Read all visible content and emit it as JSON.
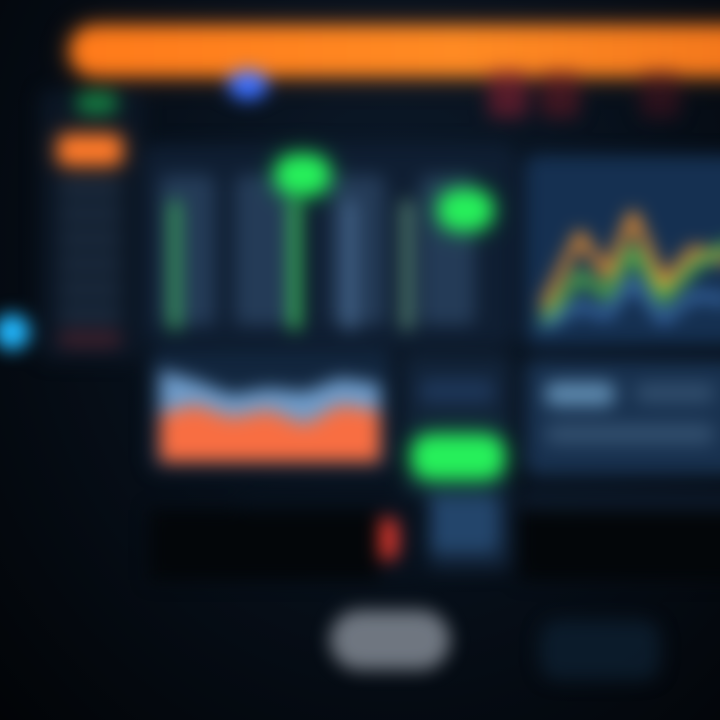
{
  "colors": {
    "background": "#03060b",
    "header_accent": "#ff7a1a",
    "sidebar_active": "#ff7a29",
    "primary_dot": "#3b6fff",
    "positive": "#26f05a",
    "negative": "#e43a2f",
    "cyan_accent": "#22b8ff",
    "panel": "#0f1e32",
    "panel_light": "#18314f",
    "line_green": "#5fd24b",
    "line_orange": "#ff9a2f",
    "area_blue": "#79a8d8",
    "area_orange": "#ff6b3b"
  },
  "icons": {
    "header_status": [
      "status-dot",
      "status-dot",
      "status-dot"
    ],
    "edge": "cyan-dot-icon",
    "toggle": "toggle-icon"
  },
  "sidebar": {
    "item_count": 9,
    "active_index": 1
  }
}
